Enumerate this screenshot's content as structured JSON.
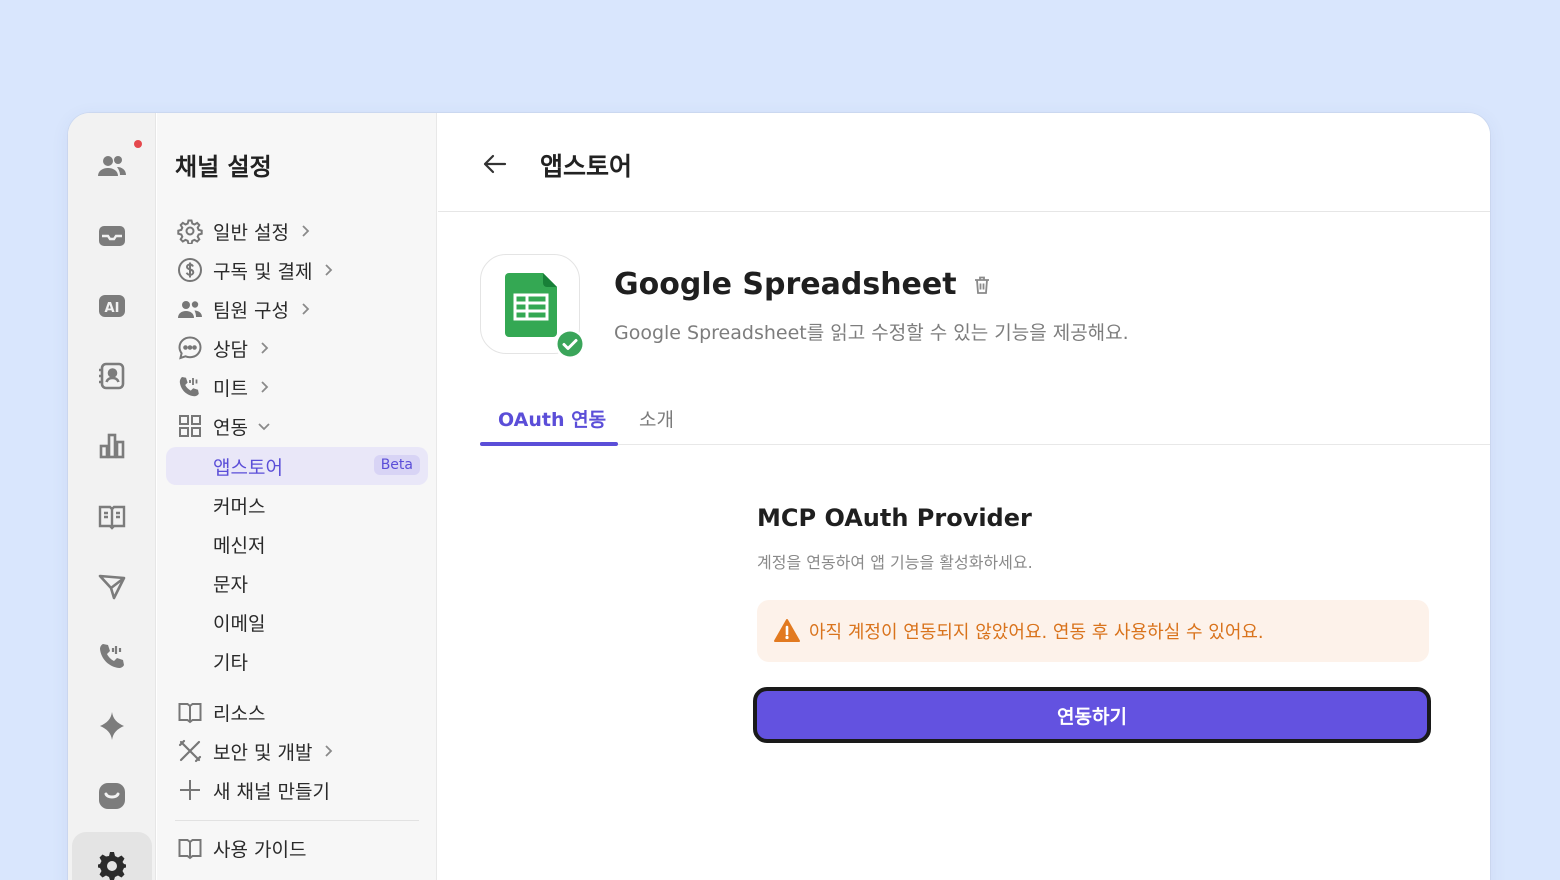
{
  "sidebar": {
    "title": "채널 설정",
    "items": [
      {
        "label": "일반 설정",
        "icon": "gear-icon"
      },
      {
        "label": "구독 및 결제",
        "icon": "dollar-icon"
      },
      {
        "label": "팀원 구성",
        "icon": "team-icon"
      },
      {
        "label": "상담",
        "icon": "chat-icon"
      },
      {
        "label": "미트",
        "icon": "phone-icon"
      },
      {
        "label": "연동",
        "icon": "grid-icon"
      }
    ],
    "integrations": [
      {
        "label": "앱스토어",
        "badge": "Beta"
      },
      {
        "label": "커머스"
      },
      {
        "label": "메신저"
      },
      {
        "label": "문자"
      },
      {
        "label": "이메일"
      },
      {
        "label": "기타"
      }
    ],
    "extras": [
      {
        "label": "리소스",
        "icon": "book-icon"
      },
      {
        "label": "보안 및 개발",
        "icon": "tools-icon"
      },
      {
        "label": "새 채널 만들기",
        "icon": "plus-icon"
      }
    ],
    "guide": {
      "label": "사용 가이드",
      "icon": "book-icon"
    }
  },
  "header": {
    "title": "앱스토어"
  },
  "app": {
    "name": "Google Spreadsheet",
    "description": "Google Spreadsheet를 읽고 수정할 수 있는 기능을 제공해요."
  },
  "tabs": [
    {
      "label": "OAuth 연동",
      "active": true
    },
    {
      "label": "소개",
      "active": false
    }
  ],
  "oauth": {
    "title": "MCP OAuth Provider",
    "description": "계정을 연동하여 앱 기능을 활성화하세요.",
    "warning": "아직 계정이 연동되지 않았어요. 연동 후 사용하실 수 있어요.",
    "button": "연동하기"
  },
  "colors": {
    "accent": "#5b4ed8",
    "button": "#6352e0",
    "warning": "#d9731c",
    "background": "#d9e6fd",
    "sheets_green": "#34a853"
  }
}
